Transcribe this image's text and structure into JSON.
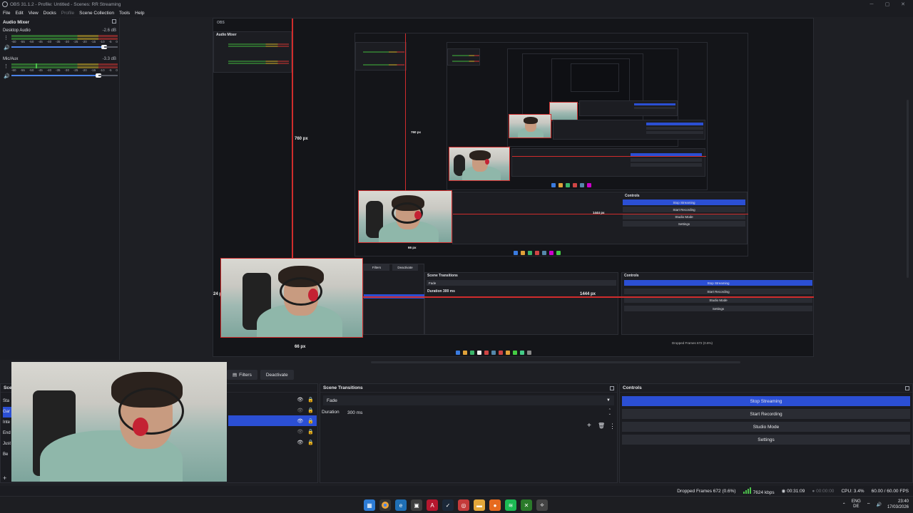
{
  "window": {
    "title": "OBS 31.1.2 - Profile: Untitled - Scenes: RR Streaming"
  },
  "menu": [
    "File",
    "Edit",
    "View",
    "Docks",
    "Profile",
    "Scene Collection",
    "Tools",
    "Help"
  ],
  "audio_mixer": {
    "title": "Audio Mixer",
    "channels": [
      {
        "name": "Desktop Audio",
        "db": "-2.6 dB"
      },
      {
        "name": "Mic/Aux",
        "db": "-3.3 dB"
      }
    ],
    "ticks": [
      "-60",
      "-55",
      "-50",
      "-45",
      "-40",
      "-35",
      "-30",
      "-25",
      "-20",
      "-15",
      "-10",
      "-5",
      "0"
    ]
  },
  "preview": {
    "label_760": "760 px",
    "label_24": "24 px",
    "label_66": "66 px",
    "label_1444": "1444 px"
  },
  "source_toolbar": {
    "filters": "Filters",
    "deactivate": "Deactivate"
  },
  "scenes": {
    "title": "Scenes",
    "items_prefix": [
      "Sta",
      "Gar",
      "Inte",
      "End",
      "Just",
      "Be"
    ]
  },
  "scene_transitions": {
    "title": "Scene Transitions",
    "selected": "Fade",
    "duration_label": "Duration",
    "duration_value": "300 ms"
  },
  "controls": {
    "title": "Controls",
    "buttons": [
      "Stop Streaming",
      "Start Recording",
      "Studio Mode",
      "Settings"
    ]
  },
  "status": {
    "dropped": "Dropped Frames 672 (0.6%)",
    "bitrate": "7624 kbps",
    "stream_time": "00:31:09",
    "rec_time": "00:00:00",
    "cpu": "CPU: 3.4%",
    "fps": "60.00 / 60.00 FPS"
  },
  "taskbar": {
    "lang_top": "ENG",
    "lang_bottom": "DE",
    "time": "23:40",
    "date": "17/03/2026"
  },
  "colors": {
    "accent": "#2b4fd4",
    "guide": "#d02c2c",
    "meter_green": "#4cc04c"
  }
}
